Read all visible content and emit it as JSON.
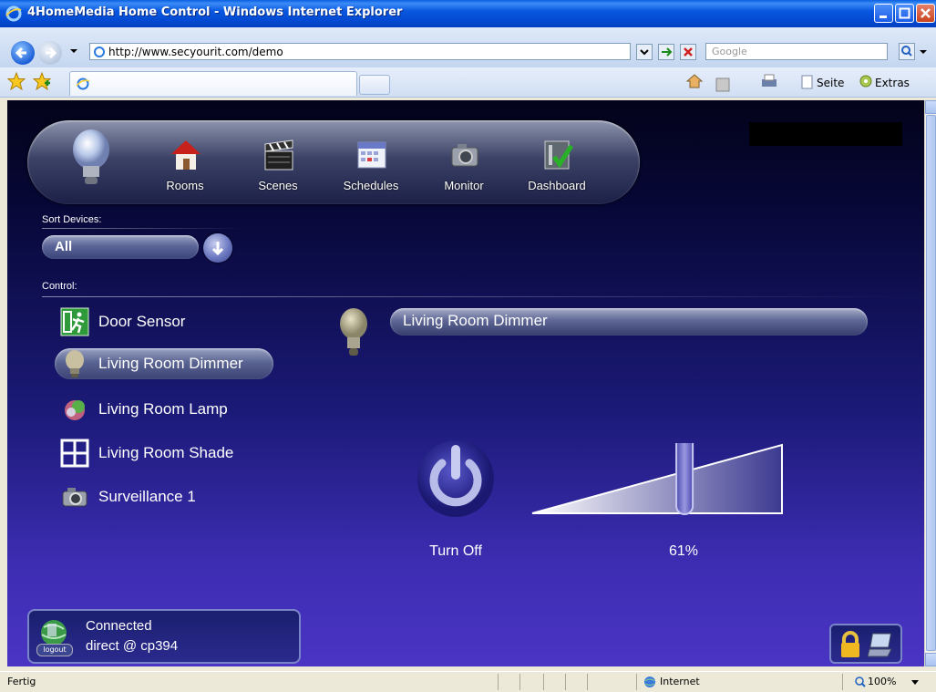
{
  "window": {
    "title": "4HomeMedia Home Control - Windows Internet Explorer"
  },
  "browser": {
    "address": "http://www.secyourit.com/demo",
    "search_placeholder": "Google",
    "command_bar": {
      "page_label": "Seite",
      "tools_label": "Extras"
    }
  },
  "app": {
    "nav_items": [
      {
        "label": "",
        "icon": "bulb-icon"
      },
      {
        "label": "Rooms",
        "icon": "house-icon"
      },
      {
        "label": "Scenes",
        "icon": "clapperboard-icon"
      },
      {
        "label": "Schedules",
        "icon": "calendar-icon"
      },
      {
        "label": "Monitor",
        "icon": "camera-icon"
      },
      {
        "label": "Dashboard",
        "icon": "dashboard-icon"
      }
    ],
    "sort_label": "Sort Devices:",
    "sort_value": "All",
    "control_label": "Control:",
    "devices": [
      {
        "label": "Door Sensor",
        "icon": "door-sensor-icon"
      },
      {
        "label": "Living Room Dimmer",
        "icon": "bulb-icon",
        "selected": true
      },
      {
        "label": "Living Room Lamp",
        "icon": "lamp-icon"
      },
      {
        "label": "Living Room Shade",
        "icon": "shade-icon"
      },
      {
        "label": "Surveillance 1",
        "icon": "camera-icon"
      }
    ],
    "detail": {
      "device_name": "Living Room Dimmer",
      "power_label": "Turn Off",
      "level_label": "61%",
      "level_value": 0.61
    },
    "status": {
      "line1": "Connected",
      "line2": "direct @ cp394",
      "logout_label": "logout"
    }
  },
  "statusbar": {
    "left": "Fertig",
    "zone": "Internet",
    "zoom": "100%"
  },
  "colors": {
    "titlebar": "#0a58e0",
    "app_bg_top": "#03031a",
    "app_bg_bottom": "#4a34c4"
  }
}
